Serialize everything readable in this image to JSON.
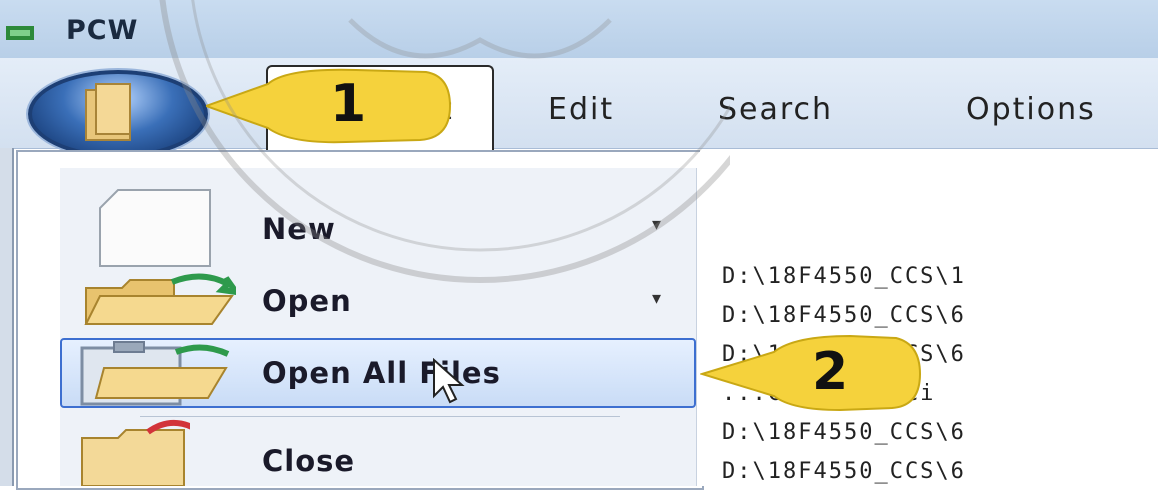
{
  "window": {
    "title": "PCW"
  },
  "menubar": {
    "file_tab_label": "t",
    "items": [
      "Edit",
      "Search",
      "Options"
    ]
  },
  "file_menu": {
    "items": [
      {
        "label": "New",
        "has_submenu": true,
        "icon": "blank-document-icon"
      },
      {
        "label": "Open",
        "has_submenu": true,
        "icon": "open-folder-icon"
      },
      {
        "label": "Open All Files",
        "has_submenu": false,
        "icon": "open-all-files-icon",
        "highlighted": true
      },
      {
        "label": "Close",
        "has_submenu": false,
        "icon": "close-folder-icon"
      }
    ],
    "recent_files": [
      "D:\\18F4550_CCS\\1",
      "D:\\18F4550_CCS\\6",
      "D:\\18F4550_CCS\\6",
      "...C\\Interfaci",
      "D:\\18F4550_CCS\\6",
      "D:\\18F4550_CCS\\6"
    ]
  },
  "callouts": [
    {
      "number": "1"
    },
    {
      "number": "2"
    }
  ],
  "colors": {
    "accent": "#3d6fd0",
    "callout": "#f5d23c",
    "titlebar": "#c9dcf0"
  }
}
